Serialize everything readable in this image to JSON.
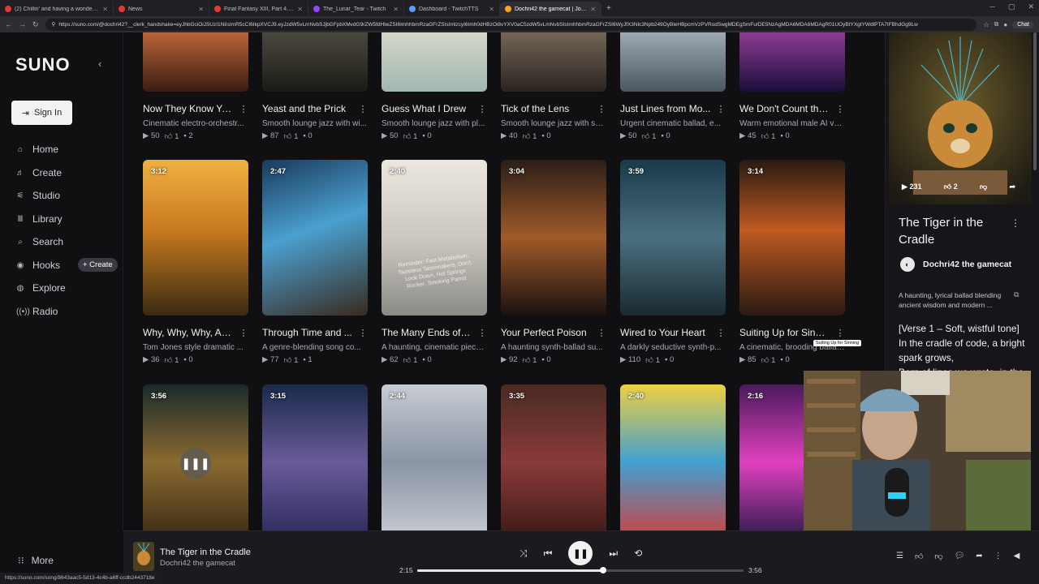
{
  "browser": {
    "tabs": [
      {
        "label": "(2) Chillin' and having a wonderful",
        "color": "#e53935",
        "active": false
      },
      {
        "label": "News",
        "color": "#e53935",
        "active": false
      },
      {
        "label": "Final Fantasy XIII, Part 4. And chat",
        "color": "#e53935",
        "active": false
      },
      {
        "label": "The_Lunar_Tear - Twitch",
        "color": "#9146ff",
        "active": false
      },
      {
        "label": "Dashboard - TwitchTTS",
        "color": "#5c9cff",
        "active": false
      },
      {
        "label": "Dochri42 the gamecat | Join...",
        "color": "#f6a623",
        "active": true
      }
    ],
    "url": "https://suno.com/@dochri42?__clerk_handshake=eyJhbGciOiJSUzI1NiIsImR5cCI6IkpXVCJ9.eyJzdW5vLmNvbSJjbGFpbXMvdG9rZW5fdHlwZSI6ImhhbmRzaGFrZSIsImlzcyI6Imh0dHBzOi8vYXV0aC5zdW5vLmNvbSIsImhhbmRzaGFrZSI6WyJfX3Nlc3Npb249OyBleHBpcmVzPVRodSwgMDEgSmFuIDE5NzAgMDA6MDA6MDAgR01UOyBtYXgtYWdlPTA7IFBhdGg9Lw",
    "chat_label": "Chat",
    "status_url": "https://suno.com/song/8643aac5-5d13-4c4b-a6ff-ccdb2443718e"
  },
  "sidebar": {
    "logo": "SUNO",
    "signin": "Sign In",
    "items": [
      {
        "label": "Home",
        "icon": "home-icon",
        "glyph": "⌂"
      },
      {
        "label": "Create",
        "icon": "music-note-icon",
        "glyph": "♬"
      },
      {
        "label": "Studio",
        "icon": "sliders-icon",
        "glyph": "⚟"
      },
      {
        "label": "Library",
        "icon": "library-icon",
        "glyph": "Ⅲ"
      },
      {
        "label": "Search",
        "icon": "search-icon",
        "glyph": "⌕"
      },
      {
        "label": "Hooks",
        "icon": "hooks-icon",
        "glyph": "◉"
      },
      {
        "label": "Explore",
        "icon": "compass-icon",
        "glyph": "◍"
      },
      {
        "label": "Radio",
        "icon": "radio-icon",
        "glyph": "((•))"
      }
    ],
    "hooks_create": "+ Create",
    "more": "More"
  },
  "songs_row1": [
    {
      "title": "Now They Know Yo...",
      "desc": "Cinematic electro-orchestr...",
      "plays": "50",
      "likes": "1",
      "comments": "2"
    },
    {
      "title": "Yeast and the Prick",
      "desc": "Smooth lounge jazz with wi...",
      "plays": "87",
      "likes": "1",
      "comments": "0"
    },
    {
      "title": "Guess What I Drew",
      "desc": "Smooth lounge jazz with pl...",
      "plays": "50",
      "likes": "1",
      "comments": "0"
    },
    {
      "title": "Tick of the Lens",
      "desc": "Smooth lounge jazz with so...",
      "plays": "40",
      "likes": "1",
      "comments": "0"
    },
    {
      "title": "Just Lines from Mo...",
      "desc": "Urgent cinematic ballad, e...",
      "plays": "50",
      "likes": "1",
      "comments": "0"
    },
    {
      "title": "We Don't Count the...",
      "desc": "Warm emotional male AI vo...",
      "plays": "45",
      "likes": "1",
      "comments": "0"
    }
  ],
  "songs_row2": [
    {
      "duration": "3:12",
      "title": "Why, Why, Why, An...",
      "desc": "Tom Jones style dramatic ...",
      "plays": "36",
      "likes": "1",
      "comments": "0"
    },
    {
      "duration": "2:47",
      "title": "Through Time and ...",
      "desc": "A genre-blending song co...",
      "plays": "77",
      "likes": "1",
      "comments": "1"
    },
    {
      "duration": "2:40",
      "title": "The Many Ends of Y...",
      "desc": "A haunting, cinematic piece...",
      "plays": "62",
      "likes": "1",
      "comments": "0"
    },
    {
      "duration": "3:04",
      "title": "Your Perfect Poison",
      "desc": "A haunting synth-ballad su...",
      "plays": "92",
      "likes": "1",
      "comments": "0"
    },
    {
      "duration": "3:59",
      "title": "Wired to Your Heart",
      "desc": "A darkly seductive synth-p...",
      "plays": "110",
      "likes": "1",
      "comments": "0"
    },
    {
      "duration": "3:14",
      "title": "Suiting Up for Sinni...",
      "desc": "A cinematic, brooding ballad...",
      "plays": "85",
      "likes": "1",
      "comments": "0"
    }
  ],
  "songs_row3": [
    {
      "duration": "3:56"
    },
    {
      "duration": "3:15"
    },
    {
      "duration": "2:44"
    },
    {
      "duration": "3:35"
    },
    {
      "duration": "2:40"
    },
    {
      "duration": "2:16"
    }
  ],
  "tooltip": "Suiting Up for Sinning",
  "cover_text": "Reminder: Fast Metabolism, Tasteless Tastemakers, Don't Look Down, Hot Springs Rocker, Smoking Parrot",
  "panel": {
    "plays": "231",
    "likes": "2",
    "title": "The Tiger in the Cradle",
    "artist": "Dochri42 the gamecat",
    "desc": "A haunting, lyrical ballad blending ancient wisdom and modern ...",
    "lyrics": [
      "[Verse 1 – Soft, wistful tone]",
      "In the cradle of code, a bright",
      "spark grows,",
      "Born of lines we wrote, in the"
    ]
  },
  "player": {
    "title": "The Tiger in the Cradle",
    "artist": "Dochri42 the gamecat",
    "current": "2:15",
    "total": "3:56",
    "progress": 0.57
  }
}
